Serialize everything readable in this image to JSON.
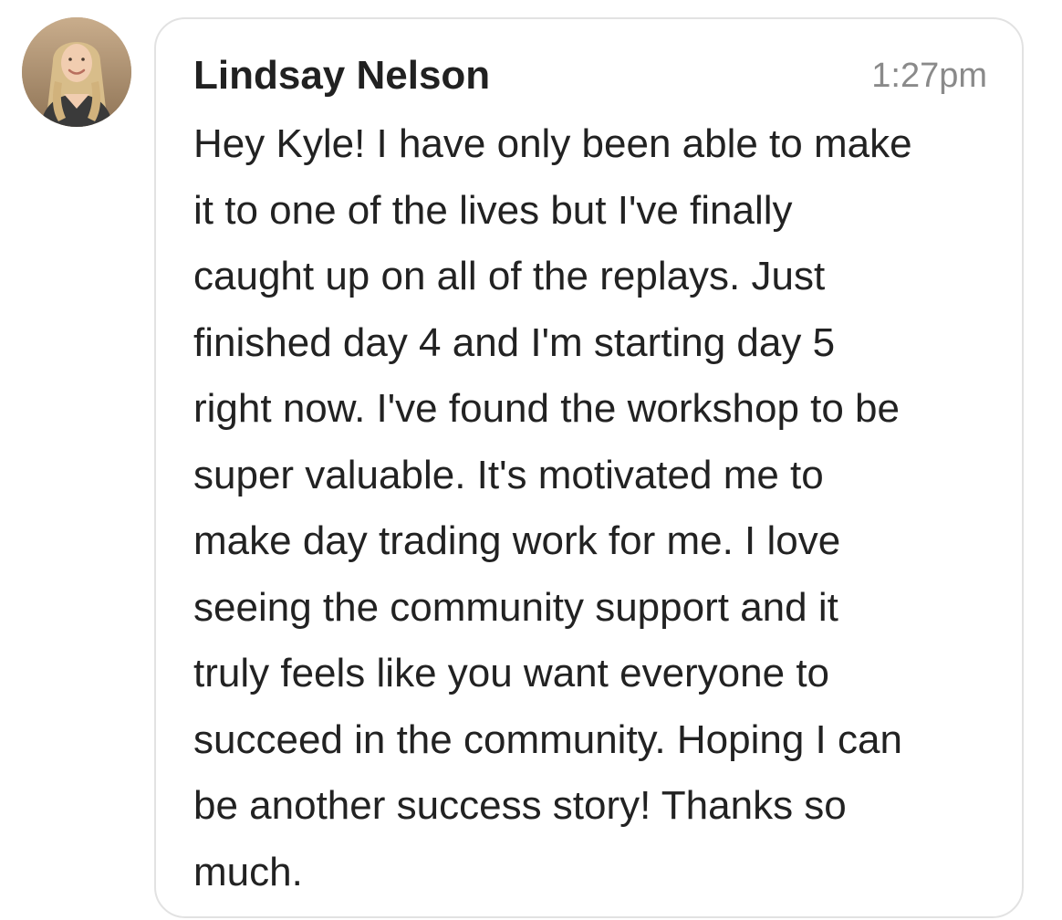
{
  "avatar": {
    "alt": "Lindsay Nelson profile photo"
  },
  "message": {
    "sender": "Lindsay Nelson",
    "time": "1:27pm",
    "lines": [
      "Hey Kyle! I have only been able to make",
      "it to one of the lives but I've finally",
      "caught up on all of the replays. Just",
      "finished day 4 and I'm starting day 5",
      "right now. I've found the workshop to be",
      "super valuable. It's motivated me to",
      "make day trading work for me. I love",
      "seeing the community support and it",
      "truly feels like you want everyone to",
      "succeed in the community. Hoping I can",
      "be another success story! Thanks so",
      "much."
    ]
  },
  "colors": {
    "bubble_border": "#e2e2e2",
    "timestamp": "#8a8a8a",
    "text": "#222222"
  }
}
